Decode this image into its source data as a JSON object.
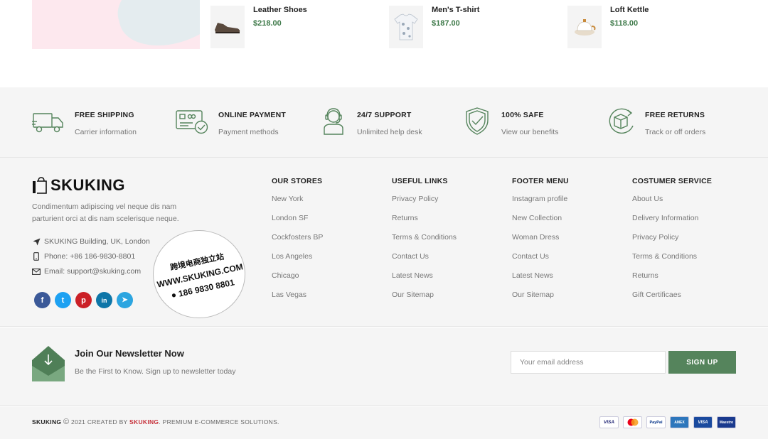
{
  "products": [
    {
      "name": "Leather Shoes",
      "price": "$218.00",
      "icon": "shoe-icon"
    },
    {
      "name": "Men's T-shirt",
      "price": "$187.00",
      "icon": "tshirt-icon"
    },
    {
      "name": "Loft Kettle",
      "price": "$118.00",
      "icon": "kettle-icon"
    }
  ],
  "features": [
    {
      "title": "FREE SHIPPING",
      "sub": "Carrier information",
      "icon": "truck-icon"
    },
    {
      "title": "ONLINE PAYMENT",
      "sub": "Payment methods",
      "icon": "payment-card-icon"
    },
    {
      "title": "24/7 SUPPORT",
      "sub": "Unlimited help desk",
      "icon": "support-agent-icon"
    },
    {
      "title": "100% SAFE",
      "sub": "View our benefits",
      "icon": "shield-check-icon"
    },
    {
      "title": "FREE RETURNS",
      "sub": "Track or off orders",
      "icon": "returns-box-icon"
    }
  ],
  "brand": {
    "logo": "SKUKING",
    "about": "Condimentum adipiscing vel neque dis nam parturient orci at dis nam scelerisque neque.",
    "address": "SKUKING Building, UK, London",
    "phone": "Phone: +86 186-9830-8801",
    "email": "Email: support@skuking.com"
  },
  "stamp": {
    "line1": "跨境电商独立站",
    "line2": "WWW.SKUKING.COM",
    "line3": "186 9830 8801"
  },
  "socials": [
    {
      "name": "facebook",
      "glyph": "f",
      "color": "#3b5998"
    },
    {
      "name": "twitter",
      "glyph": "t",
      "color": "#1da1f2"
    },
    {
      "name": "pinterest",
      "glyph": "p",
      "color": "#cb2027"
    },
    {
      "name": "linkedin",
      "glyph": "in",
      "color": "#0e76a8"
    },
    {
      "name": "telegram",
      "glyph": "➤",
      "color": "#2ca5e0"
    }
  ],
  "columns": [
    {
      "title": "OUR STORES",
      "items": [
        "New York",
        "London SF",
        "Cockfosters BP",
        "Los Angeles",
        "Chicago",
        "Las Vegas"
      ]
    },
    {
      "title": "USEFUL LINKS",
      "items": [
        "Privacy Policy",
        "Returns",
        "Terms & Conditions",
        "Contact Us",
        "Latest News",
        "Our Sitemap"
      ]
    },
    {
      "title": "FOOTER MENU",
      "items": [
        "Instagram profile",
        "New Collection",
        "Woman Dress",
        "Contact Us",
        "Latest News",
        "Our Sitemap"
      ]
    },
    {
      "title": "COSTUMER SERVICE",
      "items": [
        "About Us",
        "Delivery Information",
        "Privacy Policy",
        "Terms & Conditions",
        "Returns",
        "Gift Certificaes"
      ]
    }
  ],
  "newsletter": {
    "title": "Join Our Newsletter Now",
    "sub": "Be the First to Know. Sign up to newsletter today",
    "placeholder": "Your email address",
    "button": "SIGN UP"
  },
  "copyright": {
    "brand": "SKUKING",
    "symbol": "©",
    "text1": "2021 CREATED BY",
    "brand2": "SKUKING",
    "text2": ". PREMIUM E-COMMERCE SOLUTIONS."
  },
  "payments": [
    {
      "name": "VISA",
      "icon": "visa-icon",
      "bg": "#ffffff",
      "fg": "#1a1f71"
    },
    {
      "name": "MC",
      "icon": "mastercard-icon",
      "bg": "#ffffff",
      "fg": "#eb001b"
    },
    {
      "name": "PayPal",
      "icon": "paypal-icon",
      "bg": "#ffffff",
      "fg": "#003087"
    },
    {
      "name": "AMEX",
      "icon": "amex-icon",
      "bg": "#2e77bc",
      "fg": "#ffffff"
    },
    {
      "name": "VISA",
      "icon": "visa-electron-icon",
      "bg": "#1a4a9e",
      "fg": "#ffffff"
    },
    {
      "name": "Maestro",
      "icon": "maestro-icon",
      "bg": "#1a3a8e",
      "fg": "#ffffff"
    }
  ],
  "colors": {
    "accent": "#55845c",
    "price": "#3f7a4a",
    "brand_red": "#c6303a"
  }
}
